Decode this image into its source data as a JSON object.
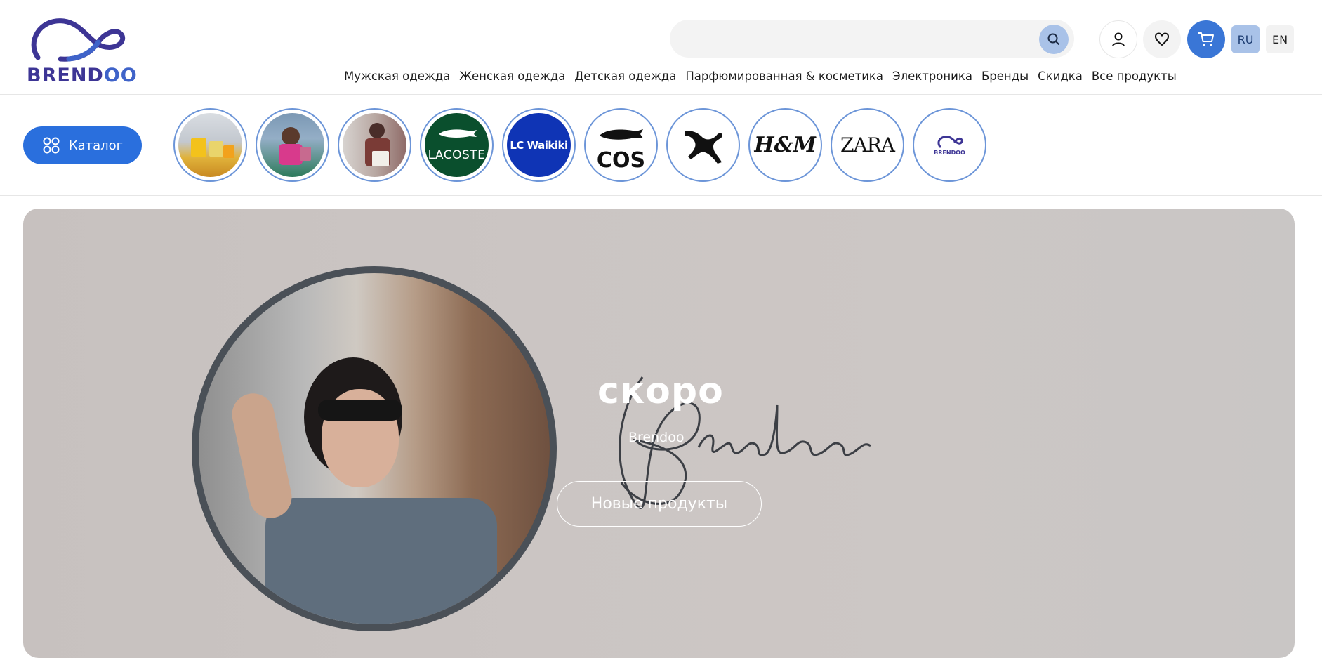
{
  "header": {
    "logo_text_part1": "BREND",
    "logo_text_part2": "OO",
    "search_placeholder": "",
    "languages": [
      "RU",
      "EN"
    ],
    "active_language": "RU",
    "nav": [
      "Мужская одежда",
      "Женская одежда",
      "Детская одежда",
      "Парфюмированная & косметика",
      "Электроника",
      "Бренды",
      "Скидка",
      "Все продукты"
    ]
  },
  "subheader": {
    "catalog_label": "Каталог",
    "stories": [
      {
        "name": "shopping-bags-story",
        "label": ""
      },
      {
        "name": "woman-shopping-story",
        "label": ""
      },
      {
        "name": "woman-bags-story",
        "label": ""
      },
      {
        "name": "lacoste-story",
        "label": "LACOSTE"
      },
      {
        "name": "lcwaikiki-story",
        "label": "LC Waikiki"
      },
      {
        "name": "cos-story",
        "label": "COS"
      },
      {
        "name": "puma-story",
        "label": ""
      },
      {
        "name": "hm-story",
        "label": "H&M"
      },
      {
        "name": "zara-story",
        "label": "ZARA"
      },
      {
        "name": "brendoo-story",
        "label": "BRENDOO"
      }
    ]
  },
  "hero": {
    "title": "скоро",
    "subtitle": "Brendoo",
    "script_text": "Brendoo",
    "button_label": "Новые продукты"
  },
  "colors": {
    "accent": "#2a6fdd",
    "brand_dark": "#3d3595",
    "brand_light": "#3f63c9"
  }
}
